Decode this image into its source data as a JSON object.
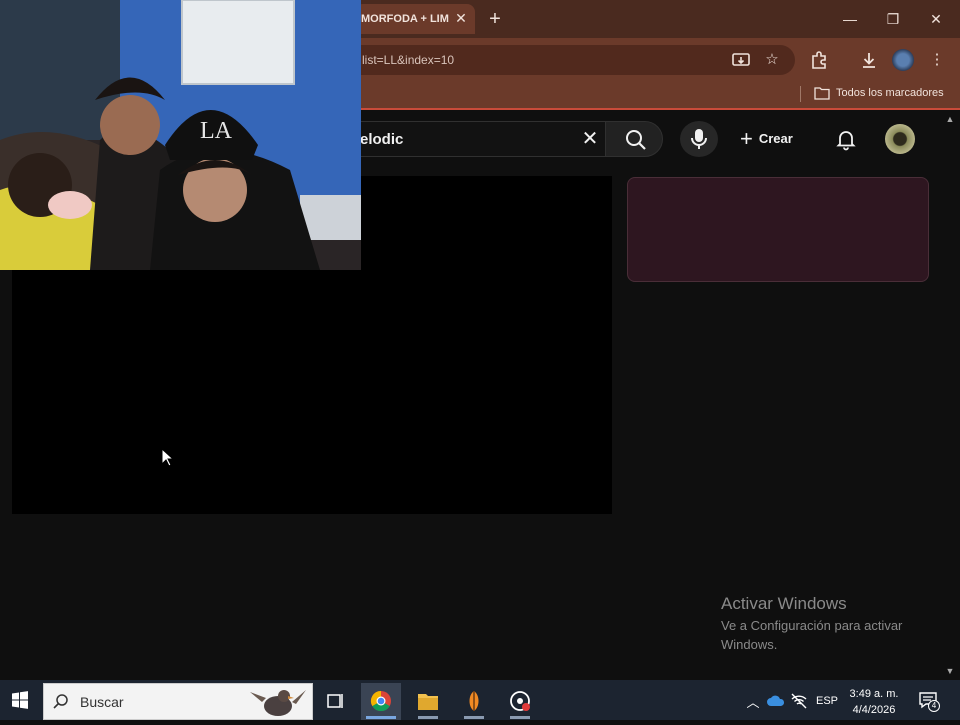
{
  "browser": {
    "tab_title": "MORFODA + LIM",
    "url": "list=LL&index=10",
    "bookmarks_label": "Todos los marcadores"
  },
  "youtube": {
    "search_query": "elodic",
    "create_label": "Crear"
  },
  "watermark": {
    "title": "Activar Windows",
    "subtitle": "Ve a Configuración para activar Windows."
  },
  "taskbar": {
    "search_placeholder": "Buscar",
    "language": "ESP",
    "time": "3:49 a. m.",
    "date": "4/4/2026",
    "notification_count": "4"
  },
  "colors": {
    "tab_bar": "#4a2a1f",
    "toolbar": "#6b3a2a",
    "yt_background": "#0f0f0f",
    "taskbar": "#1c2430",
    "side_card": "#2e1620"
  }
}
